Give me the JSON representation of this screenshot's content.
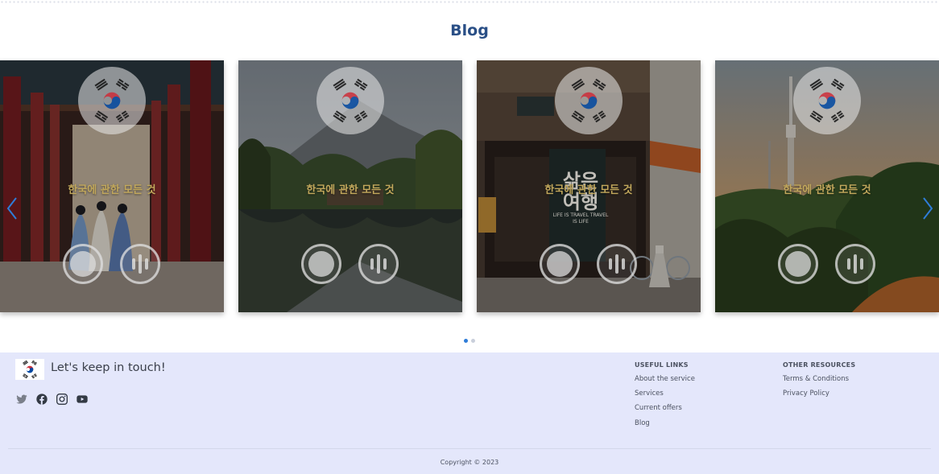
{
  "blog": {
    "title": "Blog",
    "cards": [
      {
        "caption": "한국에 관한 모든 것",
        "scene": "palace-hanbok"
      },
      {
        "caption": "한국에 관한 모든 것",
        "scene": "lake-mountain"
      },
      {
        "caption": "한국에 관한 모든 것",
        "scene": "street-cafe",
        "sign_text_top": "삶은",
        "sign_text_bottom": "여행",
        "sign_small": "LIFE IS TRAVEL TRAVEL IS LIFE"
      },
      {
        "caption": "한국에 관한 모든 것",
        "scene": "namsan-tower"
      }
    ],
    "pagination": {
      "total": 2,
      "active": 0
    }
  },
  "footer": {
    "tagline": "Let's keep in touch!",
    "social": [
      "twitter-icon",
      "facebook-icon",
      "instagram-icon",
      "youtube-icon"
    ],
    "useful_links": {
      "heading": "USEFUL LINKS",
      "items": [
        "About the service",
        "Services",
        "Current offers",
        "Blog"
      ]
    },
    "other_resources": {
      "heading": "OTHER RESOURCES",
      "items": [
        "Terms & Conditions",
        "Privacy Policy"
      ]
    },
    "copyright": "Copyright © 2023"
  },
  "colors": {
    "title": "#2a4f86",
    "footer_bg": "#e4e7fb",
    "caption": "#c2a85c",
    "arrow": "#2f7dd8",
    "flag_red": "#cd2e3a",
    "flag_blue": "#0047a0"
  }
}
